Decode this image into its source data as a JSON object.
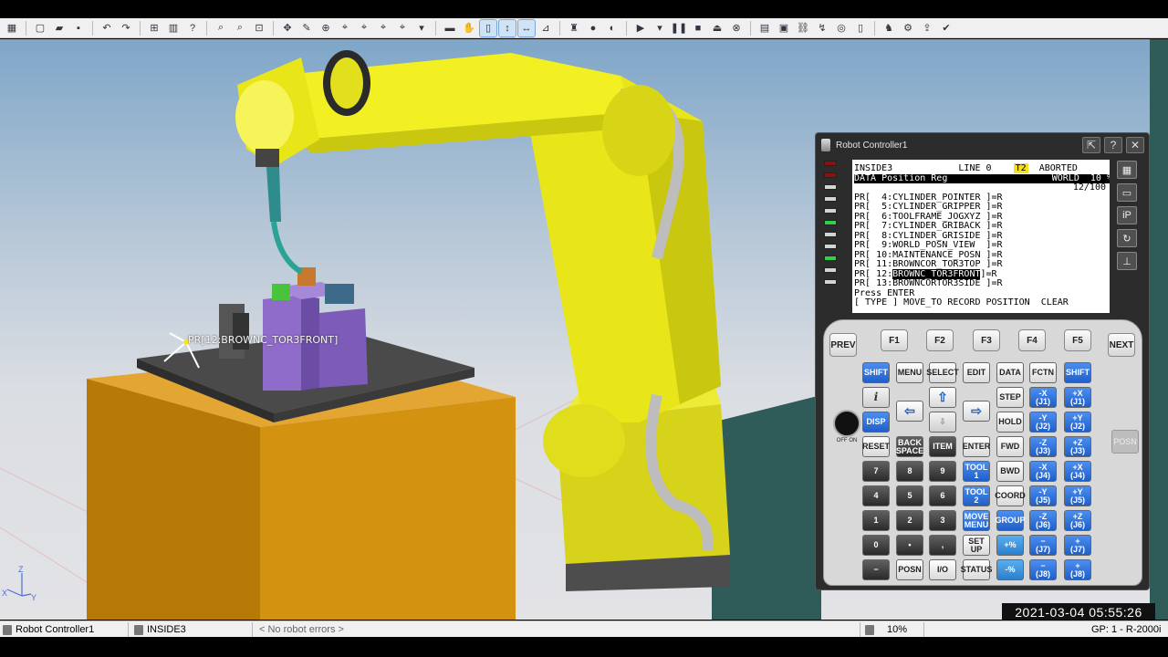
{
  "toolbar": {
    "icons": [
      "grid-icon",
      "new-icon",
      "open-icon",
      "save-icon",
      "undo-icon",
      "redo-icon",
      "hierarchy-icon",
      "chart-icon",
      "help-icon",
      "zoom-icon",
      "zoom-area-icon",
      "zoom-fit-icon",
      "move-icon",
      "edit-icon",
      "target-icon",
      "frame-icon",
      "frame2-icon",
      "frame3-icon",
      "frame4-icon",
      "drop-icon",
      "ruler-icon",
      "hand-icon",
      "teach-pendant-icon",
      "jog-icon",
      "jog-frame-icon",
      "measure-icon",
      "robot-icon",
      "record-icon",
      "cycle-icon",
      "play-icon",
      "play-dropdown-icon",
      "pause-icon",
      "stop-icon",
      "eject-icon",
      "abort-icon",
      "run-panel-icon",
      "program-icon",
      "link-icon",
      "path-icon",
      "target2-icon",
      "pendant-icon",
      "robot2-icon",
      "settings-icon",
      "export-icon",
      "checkmark-icon"
    ]
  },
  "viewport": {
    "pr_label": "PR[12:BROWNC_TOR3FRONT]",
    "timestamp": "2021-03-04 05:55:26",
    "axis": {
      "z": "Z",
      "x": "X",
      "y": "Y"
    }
  },
  "controller": {
    "title": "Robot Controller1",
    "screen": {
      "header_left": "INSIDE3",
      "header_line": "LINE 0",
      "header_mode": "T2",
      "header_status": "ABORTED",
      "subheader_left": "DATA Position Reg",
      "subheader_right": "WORLD  10 %",
      "counter": "12/100",
      "rows": [
        "PR[  4:CYLINDER_POINTER ]=R",
        "PR[  5:CYLINDER_GRIPPER ]=R",
        "PR[  6:TOOLFRAME_JOGXYZ ]=R",
        "PR[  7:CYLINDER_GRIBACK ]=R",
        "PR[  8:CYLINDER_GRISIDE ]=R",
        "PR[  9:WORLD_POSN_VIEW  ]=R",
        "PR[ 10:MAINTENANCE_POSN ]=R",
        "PR[ 11:BROWNCOR_TOR3TOP ]=R"
      ],
      "selected_prefix": "PR[ 12:",
      "selected_name": "BROWNC_TOR3FRONT",
      "selected_suffix": "]=R",
      "last_row": "PR[ 13:BROWNCORTOR3SIDE ]=R",
      "prompt": "Press ENTER",
      "footer": "[ TYPE ] MOVE_TO RECORD POSITION  CLEAR"
    },
    "keypad": {
      "prev": "PREV",
      "next": "NEXT",
      "f1": "F1",
      "f2": "F2",
      "f3": "F3",
      "f4": "F4",
      "f5": "F5",
      "shift": "SHIFT",
      "menu": "MENU",
      "select": "SELECT",
      "edit": "EDIT",
      "data": "DATA",
      "fctn": "FCTN",
      "info": "i",
      "disp": "DISP",
      "step": "STEP",
      "hold": "HOLD",
      "reset": "RESET",
      "backspace": "BACK\nSPACE",
      "item": "ITEM",
      "enter": "ENTER",
      "fwd": "FWD",
      "bwd": "BWD",
      "coord": "COORD",
      "group": "GROUP",
      "tool1": "TOOL\n1",
      "tool2": "TOOL\n2",
      "move_menu": "MOVE\nMENU",
      "setup": "SET\nUP",
      "status": "STATUS",
      "posn": "POSN",
      "io": "I/O",
      "minus": "−",
      "comma": ",",
      "dot": "•",
      "digits": [
        "7",
        "8",
        "9",
        "4",
        "5",
        "6",
        "1",
        "2",
        "3",
        "0"
      ],
      "jog": [
        {
          "neg": "-X\n(J1)",
          "pos": "+X\n(J1)"
        },
        {
          "neg": "-Y\n(J2)",
          "pos": "+Y\n(J2)"
        },
        {
          "neg": "-Z\n(J3)",
          "pos": "+Z\n(J3)"
        },
        {
          "neg": "-X\n(J4)",
          "pos": "+X\n(J4)"
        },
        {
          "neg": "-Y\n(J5)",
          "pos": "+Y\n(J5)"
        },
        {
          "neg": "-Z\n(J6)",
          "pos": "+Z\n(J6)"
        },
        {
          "neg": "−\n(J7)",
          "pos": "+\n(J7)"
        },
        {
          "neg": "−\n(J8)",
          "pos": "+\n(J8)"
        }
      ],
      "speed_up": "+%",
      "speed_down": "-%",
      "estop_label": "OFF  ON",
      "posn_side": "POSN"
    }
  },
  "statusbar": {
    "controller": "Robot Controller1",
    "program": "INSIDE3",
    "errors": "< No robot errors >",
    "speed": "10%",
    "group": "GP: 1 - R-2000i"
  },
  "colors": {
    "robot_yellow": "#e8e619",
    "table_orange": "#c98a0c",
    "floor": "#d9dbe0",
    "fixture_purple": "#8e6fc6",
    "accent_blue": "#1f5fc9"
  }
}
